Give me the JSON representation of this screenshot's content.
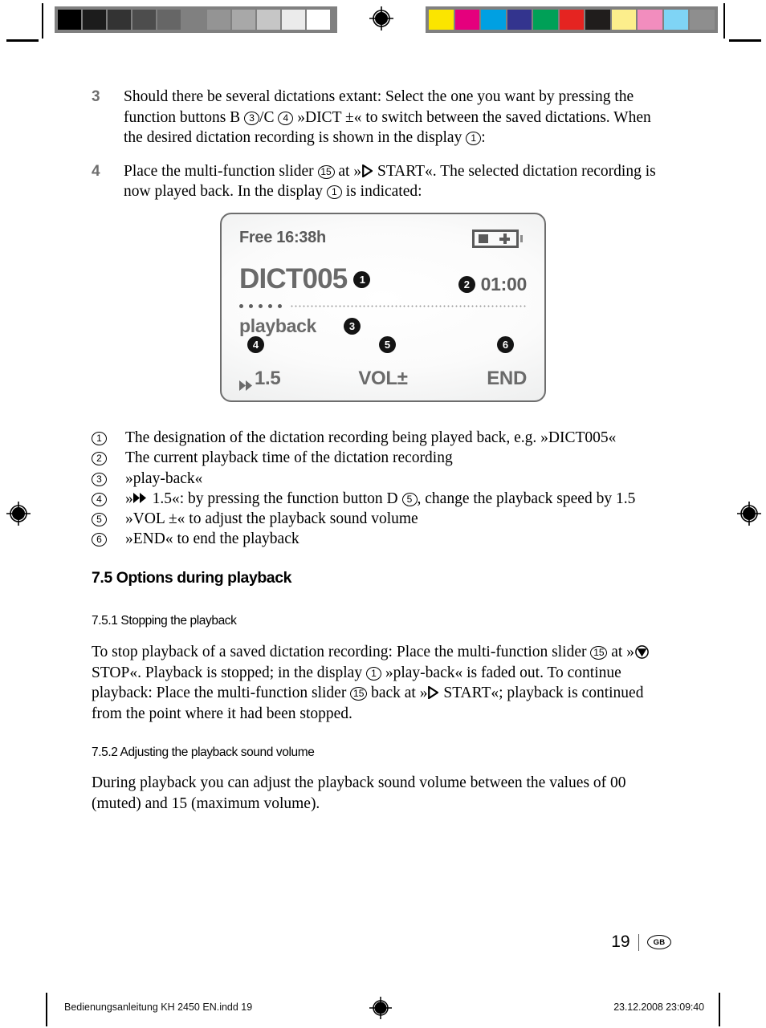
{
  "document": {
    "page_number": "19",
    "language_badge": "GB"
  },
  "calibration": {
    "grayscale_swatches": [
      "#000000",
      "#1c1c1c",
      "#333333",
      "#4d4d4d",
      "#666666",
      "#808080",
      "#949494",
      "#a8a8a8",
      "#c6c6c6",
      "#ebebeb",
      "#ffffff"
    ],
    "color_swatches": [
      "#fbe500",
      "#e5007d",
      "#00a0e2",
      "#33348e",
      "#00a057",
      "#e52421",
      "#201d1c",
      "#fcee8c",
      "#f28dbe",
      "#7fd4f5",
      "#8e8e8e"
    ]
  },
  "steps": [
    {
      "number": "3",
      "segments": [
        {
          "t": "text",
          "v": "Should there be several dictations extant: Select the one you want by pressing the function buttons B "
        },
        {
          "t": "circ",
          "v": "3"
        },
        {
          "t": "text",
          "v": "/C "
        },
        {
          "t": "circ",
          "v": "4"
        },
        {
          "t": "text",
          "v": " »DICT ±« to switch between the saved dictations. When the desired dictation recording is shown in the display "
        },
        {
          "t": "circ",
          "v": "1"
        },
        {
          "t": "text",
          "v": ":"
        }
      ]
    },
    {
      "number": "4",
      "segments": [
        {
          "t": "text",
          "v": "Place the multi-function slider "
        },
        {
          "t": "circ",
          "v": "15"
        },
        {
          "t": "text",
          "v": " at »"
        },
        {
          "t": "icon",
          "v": "play-triangle-icon"
        },
        {
          "t": "text",
          "v": " START«. The selected dictation recording is now played back. In the display "
        },
        {
          "t": "circ",
          "v": "1"
        },
        {
          "t": "text",
          "v": " is indicated:"
        }
      ]
    }
  ],
  "lcd": {
    "free_label": "Free 16:38h",
    "battery_icon": "battery-icon",
    "dictation_name": "DICT005",
    "dictation_callout": "1",
    "time_callout": "2",
    "playback_time": "01:00",
    "progress_filled_dots": 5,
    "status_label": "playback",
    "status_callout": "3",
    "soft_keys": [
      {
        "callout": "4",
        "icon": "fast-forward-icon",
        "label": "1.5"
      },
      {
        "callout": "5",
        "icon": "",
        "label": "VOL±"
      },
      {
        "callout": "6",
        "icon": "",
        "label": "END"
      }
    ]
  },
  "legend": [
    {
      "key": "1",
      "segments": [
        {
          "t": "text",
          "v": "The designation of the dictation recording being played back, e.g. »DICT005«"
        }
      ]
    },
    {
      "key": "2",
      "segments": [
        {
          "t": "text",
          "v": "The current playback time of the dictation recording"
        }
      ]
    },
    {
      "key": "3",
      "segments": [
        {
          "t": "text",
          "v": "»play-back«"
        }
      ]
    },
    {
      "key": "4",
      "segments": [
        {
          "t": "text",
          "v": "»"
        },
        {
          "t": "icon",
          "v": "fast-forward-icon"
        },
        {
          "t": "text",
          "v": " 1.5«: by pressing the function button D "
        },
        {
          "t": "circ",
          "v": "5"
        },
        {
          "t": "text",
          "v": ", change the playback speed by 1.5"
        }
      ]
    },
    {
      "key": "5",
      "segments": [
        {
          "t": "text",
          "v": "»VOL ±« to adjust the playback sound volume"
        }
      ]
    },
    {
      "key": "6",
      "segments": [
        {
          "t": "text",
          "v": "»END« to end the playback"
        }
      ]
    }
  ],
  "sections": {
    "h2_options": "7.5 Options during playback",
    "h3_stopping": "7.5.1 Stopping the playback",
    "stopping_segments": [
      {
        "t": "text",
        "v": "To stop playback of a saved dictation recording: Place the multi-function slider "
      },
      {
        "t": "circ",
        "v": "15"
      },
      {
        "t": "text",
        "v": " at »"
      },
      {
        "t": "icon",
        "v": "stop-icon"
      },
      {
        "t": "text",
        "v": " STOP«. Playback is stopped; in the display "
      },
      {
        "t": "circ",
        "v": "1"
      },
      {
        "t": "text",
        "v": " »play-back« is faded out. To continue playback: Place the multi-function slider "
      },
      {
        "t": "circ",
        "v": "15"
      },
      {
        "t": "text",
        "v": " back at »"
      },
      {
        "t": "icon",
        "v": "play-triangle-icon"
      },
      {
        "t": "text",
        "v": " START«; playback is continued from the point where it had been stopped."
      }
    ],
    "h3_volume": "7.5.2 Adjusting the playback sound volume",
    "volume_segments": [
      {
        "t": "text",
        "v": "During playback you can adjust the playback sound volume between the values of 00 (muted) and 15 (maximum volume)."
      }
    ]
  },
  "print_footer": {
    "file": "Bedienungsanleitung KH 2450 EN.indd   19",
    "timestamp": "23.12.2008   23:09:40"
  }
}
